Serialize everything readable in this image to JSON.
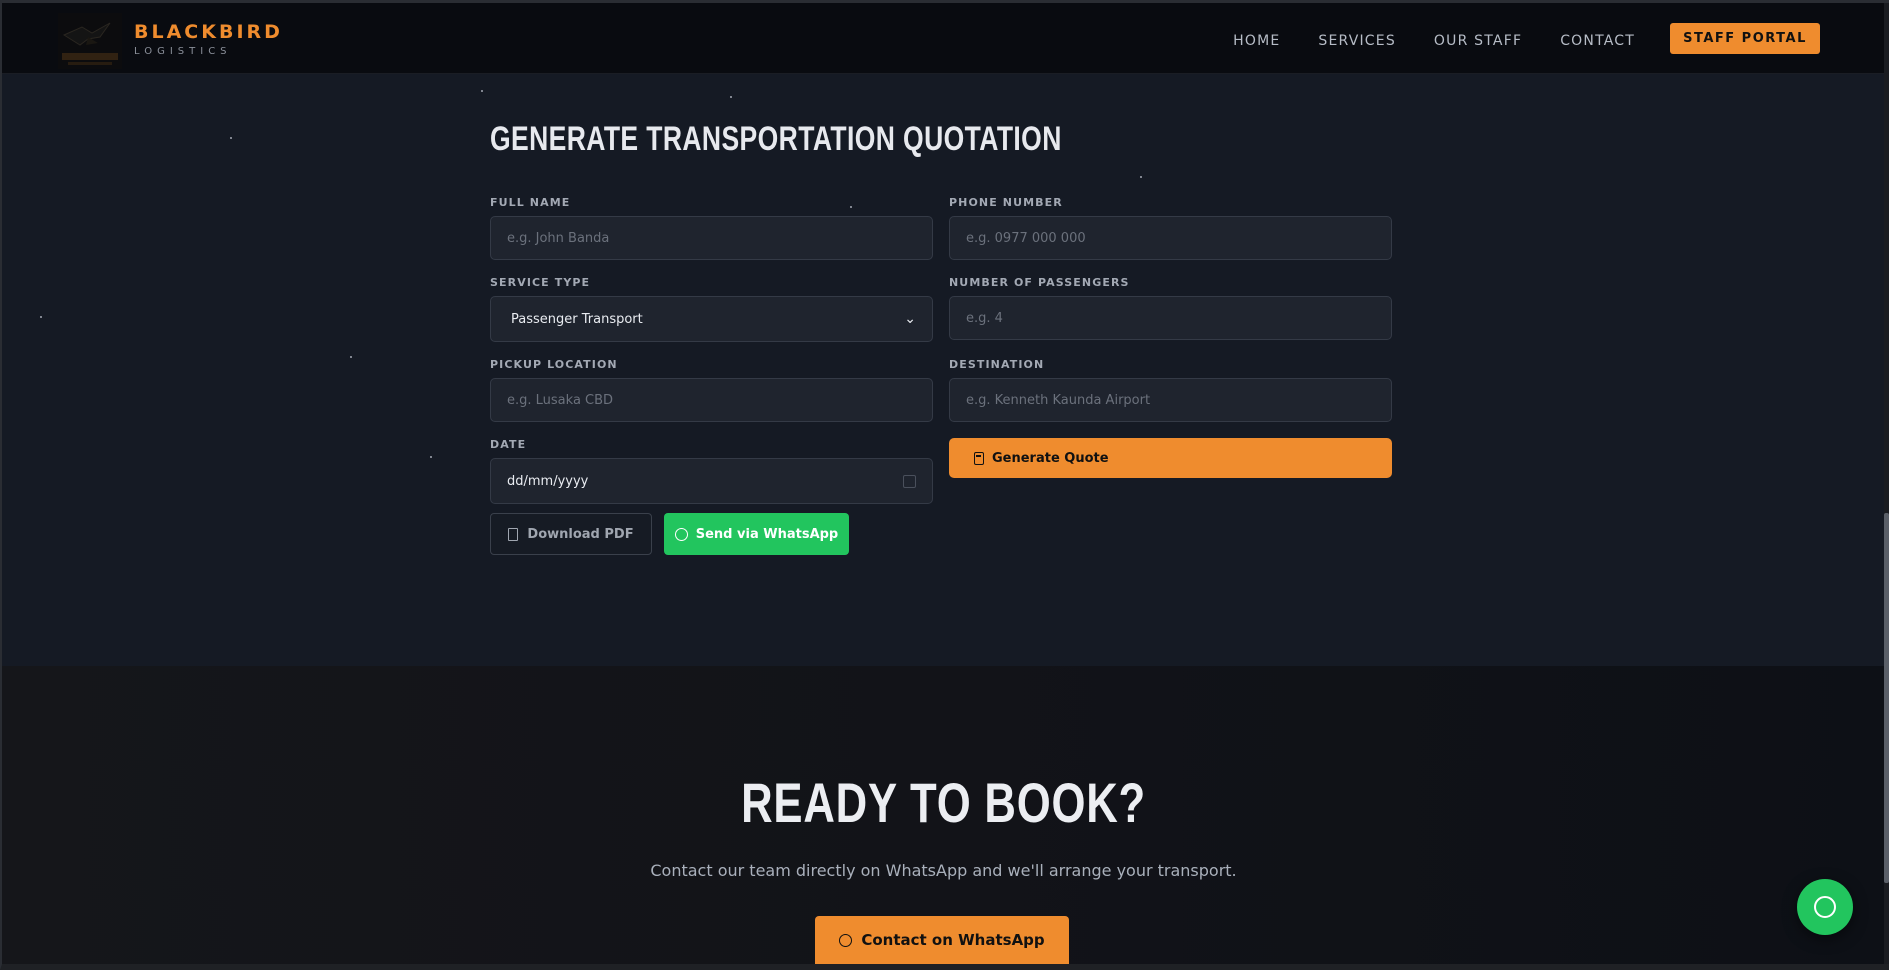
{
  "nav": {
    "brand_name": "BLACKBIRD",
    "brand_sub": "LOGISTICS",
    "links": [
      "HOME",
      "SERVICES",
      "OUR STAFF",
      "CONTACT"
    ],
    "portal_label": "STAFF PORTAL"
  },
  "quote": {
    "title": "GENERATE TRANSPORTATION QUOTATION",
    "full_name_label": "FULL NAME",
    "full_name_placeholder": "e.g. John Banda",
    "phone_label": "PHONE NUMBER",
    "phone_placeholder": "e.g. 0977 000 000",
    "service_label": "SERVICE TYPE",
    "service_value": "Passenger Transport",
    "passengers_label": "NUMBER OF PASSENGERS",
    "passengers_placeholder": "e.g. 4",
    "pickup_label": "PICKUP LOCATION",
    "pickup_placeholder": "e.g. Lusaka CBD",
    "destination_label": "DESTINATION",
    "destination_placeholder": "e.g. Kenneth Kaunda Airport",
    "date_label": "DATE",
    "date_value": "dd/mm/yyyy",
    "generate_label": "Generate Quote",
    "pdf_label": "Download PDF",
    "whatsapp_label": "Send via WhatsApp"
  },
  "book": {
    "title": "READY TO BOOK?",
    "subtitle": "Contact our team directly on WhatsApp and we'll arrange your transport.",
    "button_label": "Contact on WhatsApp"
  },
  "colors": {
    "accent": "#ef8c2e",
    "whatsapp": "#22c55e",
    "background": "#151a24"
  }
}
